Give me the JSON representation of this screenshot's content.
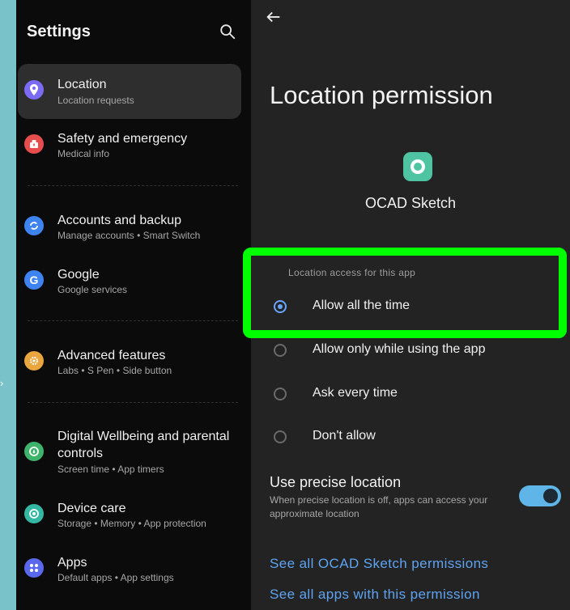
{
  "settings": {
    "title": "Settings",
    "items": [
      {
        "title": "Location",
        "subtitle": "Location requests",
        "icon": "location-pin-icon",
        "color": "#7b6cf6"
      },
      {
        "title": "Safety and emergency",
        "subtitle": "Medical info",
        "icon": "alert-icon",
        "color": "#e84d4d"
      },
      {
        "title": "Accounts and backup",
        "subtitle": "Manage accounts • Smart Switch",
        "icon": "sync-icon",
        "color": "#3d84f0"
      },
      {
        "title": "Google",
        "subtitle": "Google services",
        "icon": "google-icon",
        "color": "#3d84f0"
      },
      {
        "title": "Advanced features",
        "subtitle": "Labs • S Pen • Side button",
        "icon": "gear-plus-icon",
        "color": "#e9a53e"
      },
      {
        "title": "Digital Wellbeing and parental",
        "title_line2": "controls",
        "subtitle": "Screen time • App timers",
        "icon": "wellbeing-icon",
        "color": "#3db36b"
      },
      {
        "title": "Device care",
        "subtitle": "Storage • Memory • App protection",
        "icon": "device-care-icon",
        "color": "#34b8a4"
      },
      {
        "title": "Apps",
        "subtitle": "Default apps • App settings",
        "icon": "apps-grid-icon",
        "color": "#5a68ee"
      }
    ]
  },
  "permission": {
    "title": "Location permission",
    "app_name": "OCAD Sketch",
    "section_label": "Location access for this app",
    "options": [
      {
        "label": "Allow all the time",
        "checked": true
      },
      {
        "label": "Allow only while using the app",
        "checked": false
      },
      {
        "label": "Ask every time",
        "checked": false
      },
      {
        "label": "Don't allow",
        "checked": false
      }
    ],
    "precise": {
      "title": "Use precise location",
      "description": "When precise location is off, apps can access your approximate location",
      "enabled": true
    },
    "links": [
      "See all OCAD Sketch permissions",
      "See all apps with this permission"
    ]
  },
  "colors": {
    "highlight": "#00ff00",
    "accent": "#5ea3f0",
    "app_icon": "#4fc4a3"
  }
}
